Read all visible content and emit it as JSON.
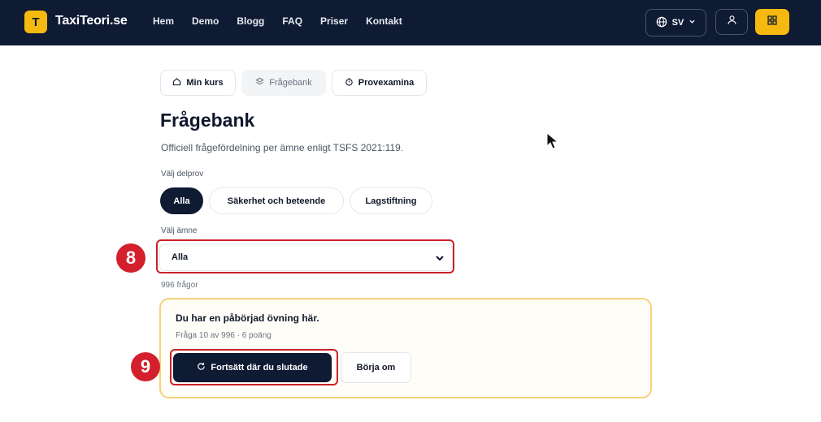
{
  "header": {
    "logo_letter": "T",
    "brand": "TaxiTeori.se",
    "nav": [
      "Hem",
      "Demo",
      "Blogg",
      "FAQ",
      "Priser",
      "Kontakt"
    ],
    "language": "SV",
    "accent": "#f5b90f",
    "background": "#0f1a33"
  },
  "tabs": [
    {
      "label": "Min kurs",
      "icon": "home-icon"
    },
    {
      "label": "Frågebank",
      "icon": "layers-icon"
    },
    {
      "label": "Provexamina",
      "icon": "stopwatch-icon"
    }
  ],
  "page": {
    "title": "Frågebank",
    "subtitle": "Officiell frågefördelning per ämne enligt TSFS 2021:119."
  },
  "delprov": {
    "label": "Välj delprov",
    "options": [
      "Alla",
      "Säkerhet och beteende",
      "Lagstiftning"
    ],
    "selected": "Alla"
  },
  "amne": {
    "label": "Välj ämne",
    "value": "Alla"
  },
  "question_count": "996 frågor",
  "resume": {
    "heading": "Du har en påbörjad övning här.",
    "progress": "Fråga 10 av 996 · 6 poäng",
    "continue_label": "Fortsätt där du slutade",
    "restart_label": "Börja om"
  },
  "annotations": {
    "marker_8": "8",
    "marker_9": "9",
    "color": "#d3202c"
  }
}
